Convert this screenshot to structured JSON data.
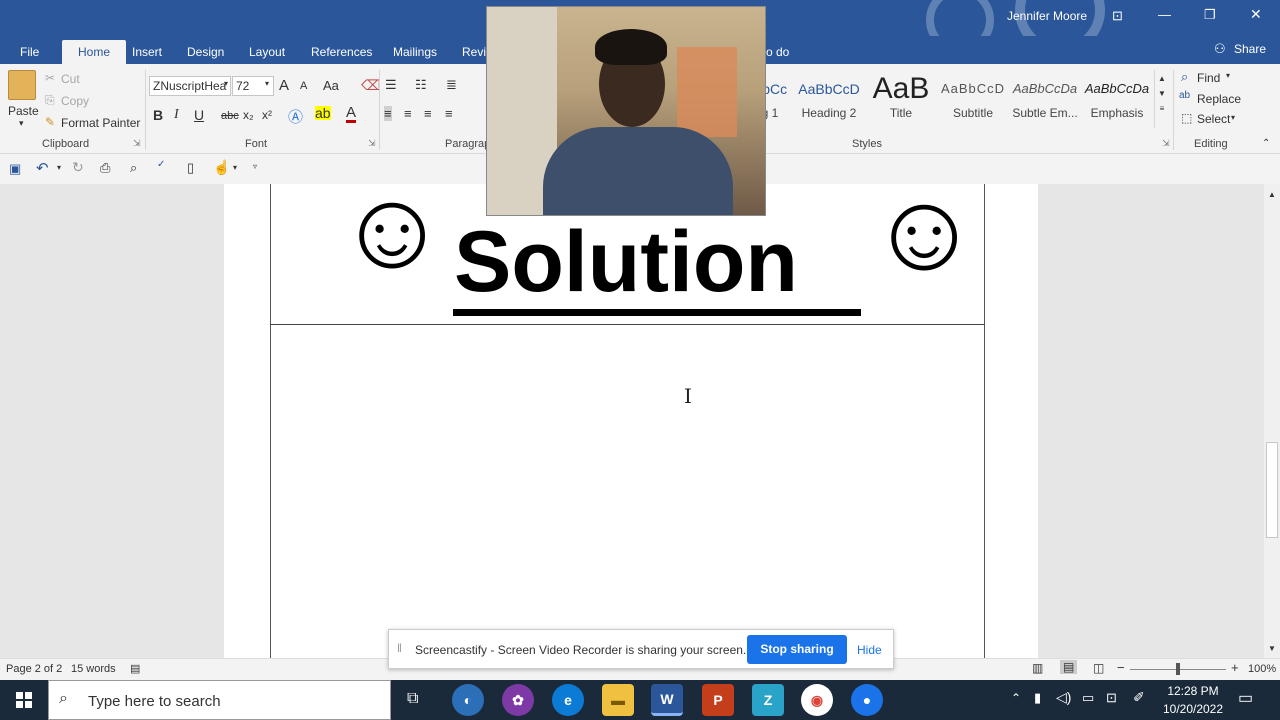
{
  "window": {
    "user": "Jennifer Moore",
    "min": "—",
    "restore": "❐",
    "close": "✕"
  },
  "tabs": [
    {
      "label": "File"
    },
    {
      "label": "Home"
    },
    {
      "label": "Insert"
    },
    {
      "label": "Design"
    },
    {
      "label": "Layout"
    },
    {
      "label": "References"
    },
    {
      "label": "Mailings"
    },
    {
      "label": "Revi"
    },
    {
      "label": "o do"
    }
  ],
  "share": {
    "label": "Share"
  },
  "clipboard": {
    "paste": "Paste",
    "cut": "Cut",
    "copy": "Copy",
    "format_painter": "Format Painter",
    "group": "Clipboard"
  },
  "font": {
    "name": "ZNuscriptHea",
    "size": "72",
    "group": "Font",
    "bold": "B",
    "italic": "I",
    "underline": "U",
    "strike": "abc",
    "sub": "x₂",
    "sup": "x²",
    "grow": "A",
    "shrink": "A",
    "case": "Aa",
    "font_color": "A"
  },
  "paragraph": {
    "group": "Paragrap"
  },
  "styles": {
    "group": "Styles",
    "items": [
      {
        "preview": "BbCc",
        "name": "g 1"
      },
      {
        "preview": "AaBbCcD",
        "name": "Heading 2"
      },
      {
        "preview": "AaB",
        "name": "Title"
      },
      {
        "preview": "AaBbCcD",
        "name": "Subtitle"
      },
      {
        "preview": "AaBbCcDa",
        "name": "Subtle Em..."
      },
      {
        "preview": "AaBbCcDa",
        "name": "Emphasis"
      }
    ]
  },
  "editing": {
    "find": "Find",
    "replace": "Replace",
    "select": "Select",
    "group": "Editing"
  },
  "document": {
    "heading": "Solution",
    "left_smiley": "☺",
    "right_smiley": "☺"
  },
  "status": {
    "page": "Page 2 of 2",
    "words": "15 words",
    "zoom": "100%",
    "zoom_level": 1.0
  },
  "screencastify": {
    "message": "Screencastify - Screen Video Recorder is sharing your screen.",
    "stop": "Stop sharing",
    "hide": "Hide"
  },
  "taskbar": {
    "search_placeholder": "Type here to search",
    "time": "12:28 PM",
    "date": "10/20/2022"
  },
  "colors": {
    "word_blue": "#2b579a",
    "stop_button": "#1a73e8"
  }
}
